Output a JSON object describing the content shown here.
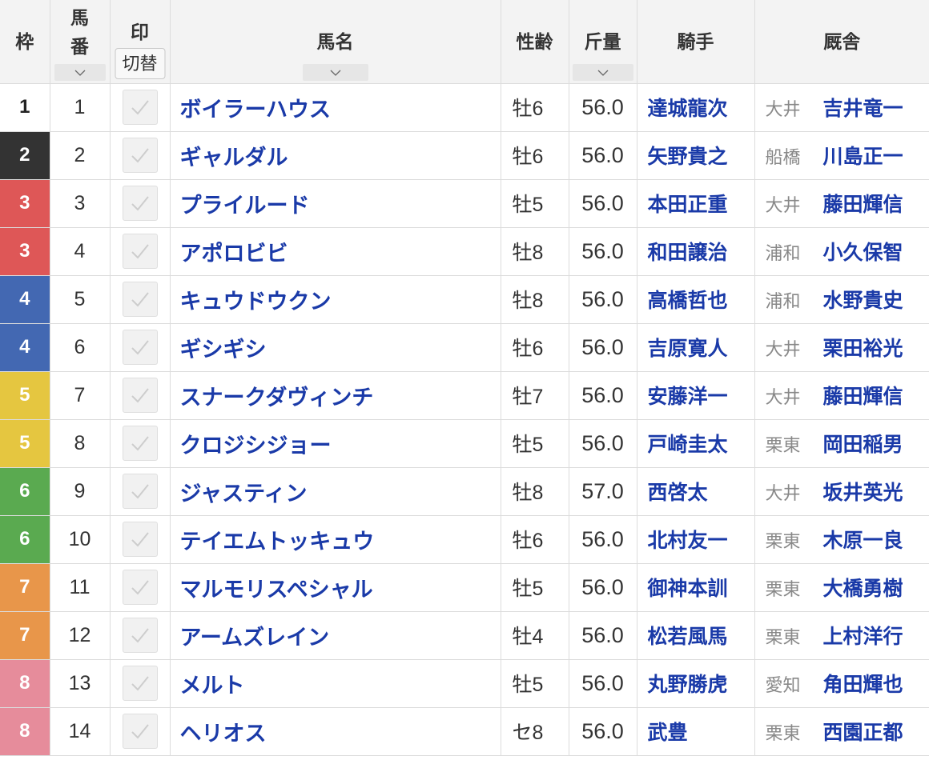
{
  "colors": {
    "link": "#1a3aa8",
    "text": "#333333",
    "muted": "#888888",
    "header_bg": "#f3f3f3",
    "border": "#dcdcdc",
    "waku_bg": {
      "1": "#ffffff",
      "2": "#333333",
      "3": "#de5757",
      "4": "#4368b2",
      "5": "#e5c640",
      "6": "#5aaa50",
      "7": "#e8964a",
      "8": "#e68c9b"
    },
    "waku_text": {
      "1": "#222222",
      "2": "#ffffff",
      "3": "#ffffff",
      "4": "#ffffff",
      "5": "#ffffff",
      "6": "#ffffff",
      "7": "#ffffff",
      "8": "#ffffff"
    }
  },
  "icons": {
    "sort": "chevron-down-icon",
    "mark": "check-icon"
  },
  "table": {
    "headers": {
      "waku": "枠",
      "umaban_top": "馬",
      "umaban_bottom": "番",
      "mark": "印",
      "mark_toggle": "切替",
      "horse_name": "馬名",
      "sex_age": "性齢",
      "weight": "斤量",
      "jockey": "騎手",
      "stable": "厩舎"
    },
    "rows": [
      {
        "waku": "1",
        "umaban": "1",
        "horse": "ボイラーハウス",
        "sex_age": "牡6",
        "weight": "56.0",
        "jockey": "達城龍次",
        "region": "大井",
        "trainer": "吉井竜一"
      },
      {
        "waku": "2",
        "umaban": "2",
        "horse": "ギャルダル",
        "sex_age": "牡6",
        "weight": "56.0",
        "jockey": "矢野貴之",
        "region": "船橋",
        "trainer": "川島正一"
      },
      {
        "waku": "3",
        "umaban": "3",
        "horse": "プライルード",
        "sex_age": "牡5",
        "weight": "56.0",
        "jockey": "本田正重",
        "region": "大井",
        "trainer": "藤田輝信"
      },
      {
        "waku": "3",
        "umaban": "4",
        "horse": "アポロビビ",
        "sex_age": "牡8",
        "weight": "56.0",
        "jockey": "和田譲治",
        "region": "浦和",
        "trainer": "小久保智"
      },
      {
        "waku": "4",
        "umaban": "5",
        "horse": "キュウドウクン",
        "sex_age": "牡8",
        "weight": "56.0",
        "jockey": "高橋哲也",
        "region": "浦和",
        "trainer": "水野貴史"
      },
      {
        "waku": "4",
        "umaban": "6",
        "horse": "ギシギシ",
        "sex_age": "牡6",
        "weight": "56.0",
        "jockey": "吉原寛人",
        "region": "大井",
        "trainer": "栗田裕光"
      },
      {
        "waku": "5",
        "umaban": "7",
        "horse": "スナークダヴィンチ",
        "sex_age": "牡7",
        "weight": "56.0",
        "jockey": "安藤洋一",
        "region": "大井",
        "trainer": "藤田輝信"
      },
      {
        "waku": "5",
        "umaban": "8",
        "horse": "クロジシジョー",
        "sex_age": "牡5",
        "weight": "56.0",
        "jockey": "戸崎圭太",
        "region": "栗東",
        "trainer": "岡田稲男"
      },
      {
        "waku": "6",
        "umaban": "9",
        "horse": "ジャスティン",
        "sex_age": "牡8",
        "weight": "57.0",
        "jockey": "西啓太",
        "region": "大井",
        "trainer": "坂井英光"
      },
      {
        "waku": "6",
        "umaban": "10",
        "horse": "テイエムトッキュウ",
        "sex_age": "牡6",
        "weight": "56.0",
        "jockey": "北村友一",
        "region": "栗東",
        "trainer": "木原一良"
      },
      {
        "waku": "7",
        "umaban": "11",
        "horse": "マルモリスペシャル",
        "sex_age": "牡5",
        "weight": "56.0",
        "jockey": "御神本訓",
        "region": "栗東",
        "trainer": "大橋勇樹"
      },
      {
        "waku": "7",
        "umaban": "12",
        "horse": "アームズレイン",
        "sex_age": "牡4",
        "weight": "56.0",
        "jockey": "松若風馬",
        "region": "栗東",
        "trainer": "上村洋行"
      },
      {
        "waku": "8",
        "umaban": "13",
        "horse": "メルト",
        "sex_age": "牡5",
        "weight": "56.0",
        "jockey": "丸野勝虎",
        "region": "愛知",
        "trainer": "角田輝也"
      },
      {
        "waku": "8",
        "umaban": "14",
        "horse": "ヘリオス",
        "sex_age": "セ8",
        "weight": "56.0",
        "jockey": "武豊",
        "region": "栗東",
        "trainer": "西園正都"
      }
    ]
  }
}
